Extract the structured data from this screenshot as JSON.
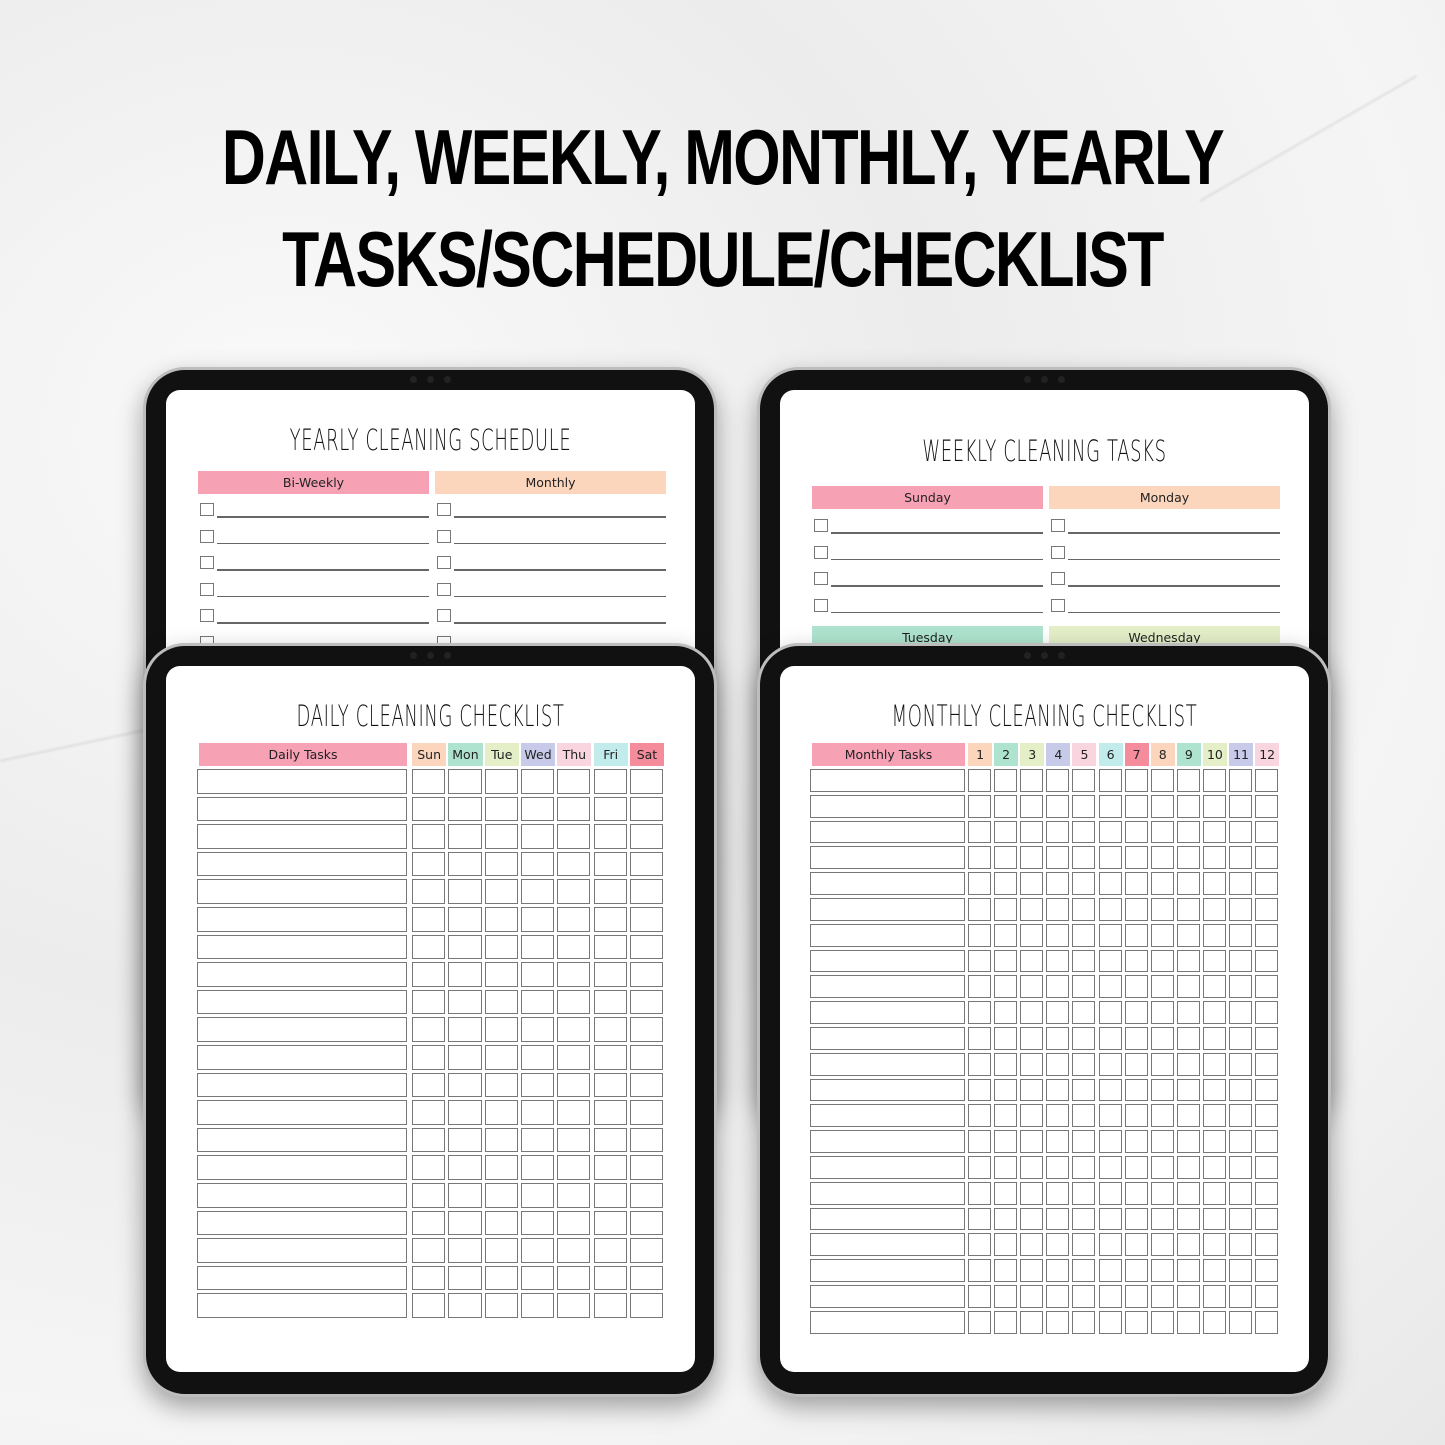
{
  "headline": {
    "line1": "DAILY, WEEKLY, MONTHLY, YEARLY",
    "line2": "TASKS/SCHEDULE/CHECKLIST"
  },
  "colors": {
    "pink": "#f7a2b4",
    "peach": "#fbd6bc",
    "mint": "#aee4cf",
    "lime": "#e4efc8",
    "lavender": "#c7cbe9",
    "blush": "#f9d5e0",
    "cyan": "#c2ecec",
    "red": "#f48c9c"
  },
  "yearly": {
    "title": "YEARLY CLEANING SCHEDULE",
    "columns": [
      "Bi-Weekly",
      "Monthly"
    ]
  },
  "weekly": {
    "title": "WEEKLY CLEANING TASKS",
    "columns": [
      "Sunday",
      "Monday"
    ],
    "next_columns": [
      "Tuesday",
      "Wednesday"
    ]
  },
  "daily": {
    "title": "DAILY CLEANING CHECKLIST",
    "task_header": "Daily Tasks",
    "days": [
      "Sun",
      "Mon",
      "Tue",
      "Wed",
      "Thu",
      "Fri",
      "Sat"
    ]
  },
  "monthly": {
    "title": "MONTHLY CLEANING CHECKLIST",
    "task_header": "Monthly Tasks",
    "months": [
      "1",
      "2",
      "3",
      "4",
      "5",
      "6",
      "7",
      "8",
      "9",
      "10",
      "11",
      "12"
    ]
  }
}
